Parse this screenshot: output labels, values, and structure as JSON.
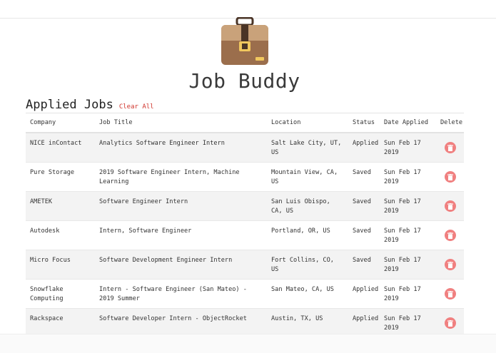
{
  "app": {
    "title": "Job Buddy"
  },
  "section": {
    "title": "Applied Jobs",
    "clear_all": "Clear All"
  },
  "table": {
    "headers": {
      "company": "Company",
      "job_title": "Job Title",
      "location": "Location",
      "status": "Status",
      "date_applied": "Date Applied",
      "delete": "Delete"
    },
    "rows": [
      {
        "company": "NICE inContact",
        "job_title": "Analytics Software Engineer Intern",
        "location": "Salt Lake City, UT, US",
        "status": "Applied",
        "date_applied": "Sun Feb 17 2019"
      },
      {
        "company": "Pure Storage",
        "job_title": "2019 Software Engineer Intern, Machine Learning",
        "location": "Mountain View, CA, US",
        "status": "Saved",
        "date_applied": "Sun Feb 17 2019"
      },
      {
        "company": "AMETEK",
        "job_title": "Software Engineer Intern",
        "location": "San Luis Obispo, CA, US",
        "status": "Saved",
        "date_applied": "Sun Feb 17 2019"
      },
      {
        "company": "Autodesk",
        "job_title": "Intern, Software Engineer",
        "location": "Portland, OR, US",
        "status": "Saved",
        "date_applied": "Sun Feb 17 2019"
      },
      {
        "company": "Micro Focus",
        "job_title": "Software Development Engineer Intern",
        "location": "Fort Collins, CO, US",
        "status": "Saved",
        "date_applied": "Sun Feb 17 2019"
      },
      {
        "company": "Snowflake Computing",
        "job_title": "Intern - Software Engineer (San Mateo) - 2019 Summer",
        "location": "San Mateo, CA, US",
        "status": "Applied",
        "date_applied": "Sun Feb 17 2019"
      },
      {
        "company": "Rackspace",
        "job_title": "Software Developer Intern - ObjectRocket",
        "location": "Austin, TX, US",
        "status": "Applied",
        "date_applied": "Sun Feb 17 2019"
      }
    ]
  },
  "colors": {
    "accent_red": "#d0342c",
    "delete_button": "#f08080",
    "briefcase": "#9b6e4c"
  },
  "icons": {
    "logo": "briefcase-icon",
    "delete": "trash-icon"
  }
}
